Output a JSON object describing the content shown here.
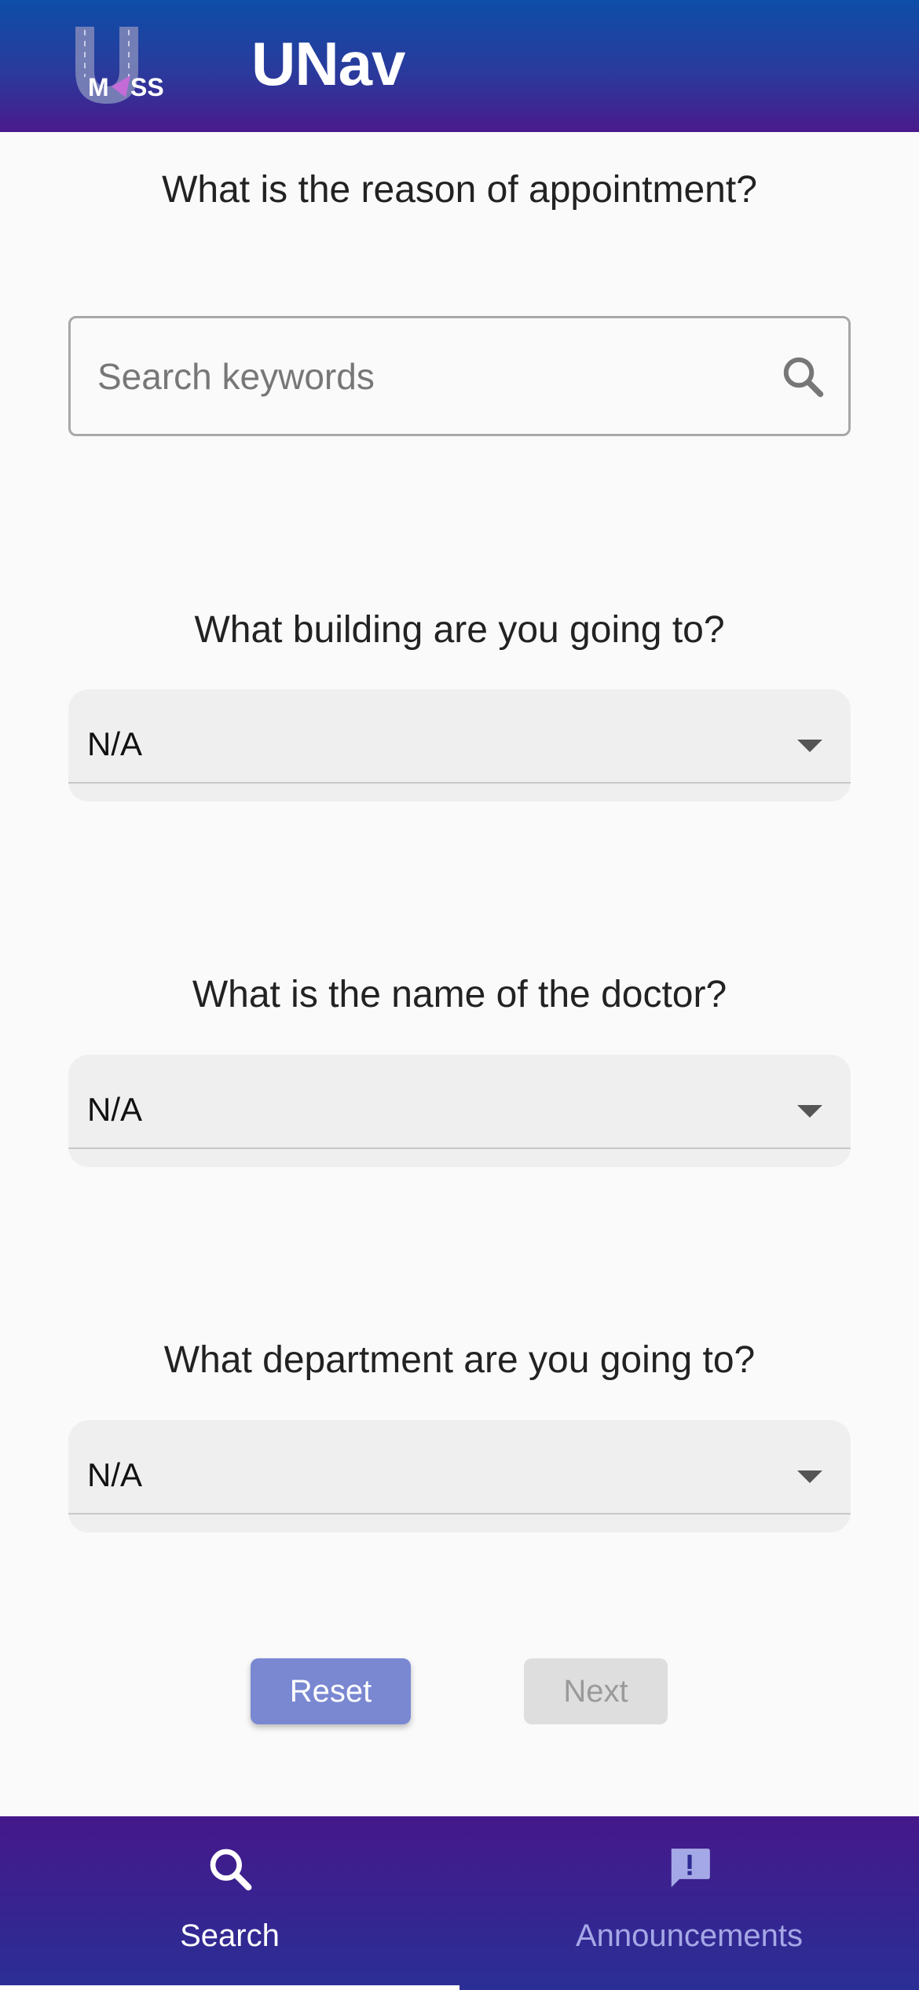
{
  "header": {
    "logo_text": "MASS",
    "title": "UNav"
  },
  "form": {
    "reason_question": "What is the reason of appointment?",
    "search_placeholder": "Search keywords",
    "search_icon": "search-icon",
    "building_question": "What building are you going to?",
    "building_value": "N/A",
    "doctor_question": "What is the name of the doctor?",
    "doctor_value": "N/A",
    "department_question": "What department are you going to?",
    "department_value": "N/A"
  },
  "buttons": {
    "reset_label": "Reset",
    "next_label": "Next"
  },
  "bottom_nav": {
    "items": [
      {
        "label": "Search",
        "icon": "search-icon",
        "active": true
      },
      {
        "label": "Announcements",
        "icon": "announcement-icon",
        "active": false
      }
    ]
  },
  "colors": {
    "header_top": "#0d4ea8",
    "header_bottom": "#4a1a8c",
    "reset_button": "#7a88d2",
    "next_button_disabled": "#dedede",
    "nav_inactive_label": "#a5a8e6",
    "logo_accent": "#c46bd8"
  }
}
